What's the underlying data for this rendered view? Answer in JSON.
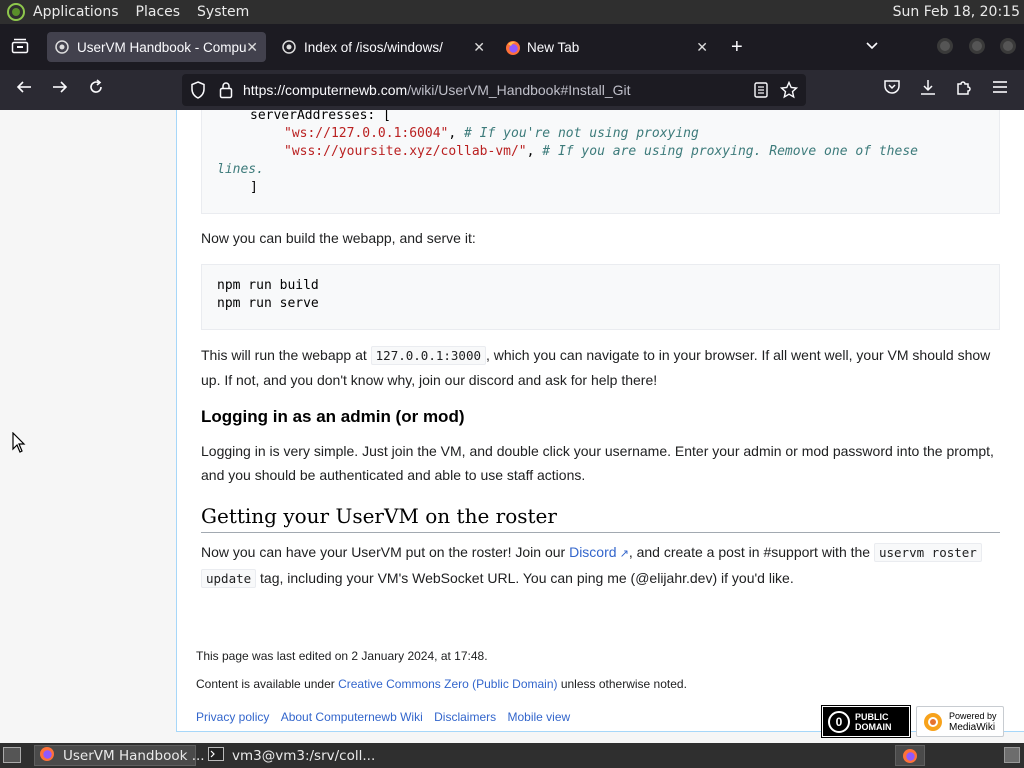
{
  "panel": {
    "menus": [
      "Applications",
      "Places",
      "System"
    ],
    "clock": "Sun Feb 18, 20:15"
  },
  "tabs": [
    {
      "label": "UserVM Handbook - Compu",
      "active": true
    },
    {
      "label": "Index of /isos/windows/",
      "active": false
    },
    {
      "label": "New Tab",
      "active": false
    }
  ],
  "url": {
    "host": "https://computernewb.com",
    "path": "/wiki/UserVM_Handbook#Install_Git"
  },
  "code1": {
    "line1": "serverAddresses: [",
    "str1": "\"ws://127.0.0.1:6004\"",
    "cmt1": "# If you're not using proxying",
    "str2": "\"wss://yoursite.xyz/collab-vm/\"",
    "cmt2": "# If you are using proxying. Remove one of these",
    "cmt2b": "lines.",
    "close": "]"
  },
  "para1": "Now you can build the webapp, and serve it:",
  "code2": {
    "line1": "npm run build",
    "line2": "npm run serve"
  },
  "para2": {
    "pre": "This will run the webapp at ",
    "code": "127.0.0.1:3000",
    "post": ", which you can navigate to in your browser. If all went well, your VM should show",
    "line2": "up. If not, and you don't know why, join our discord and ask for help there!"
  },
  "heading_admin": "Logging in as an admin (or mod)",
  "para3": {
    "line1": "Logging in is very simple. Just join the VM, and double click your username. Enter your admin or mod password into the prompt,",
    "line2": "and you should be authenticated and able to use staff actions."
  },
  "heading_roster": "Getting your UserVM on the roster",
  "para4": {
    "pre": "Now you can have your UserVM put on the roster! Join our ",
    "link": "Discord",
    "mid": ", and create a post in #support with the ",
    "code1": "uservm roster",
    "code2": "update",
    "post": " tag, including your VM's WebSocket URL. You can ping me (@elijahr.dev) if you'd like."
  },
  "footer": {
    "last_edited": "This page was last edited on 2 January 2024, at 17:48.",
    "license_pre": "Content is available under ",
    "license_link": "Creative Commons Zero (Public Domain)",
    "license_post": " unless otherwise noted.",
    "links": [
      "Privacy policy",
      "About Computernewb Wiki",
      "Disclaimers",
      "Mobile view"
    ],
    "badge_pd": "PUBLIC DOMAIN",
    "badge_mw_top": "Powered by",
    "badge_mw_bottom": "MediaWiki"
  },
  "taskbar": {
    "items": [
      "UserVM Handbook ...",
      "vm3@vm3:/srv/coll..."
    ]
  }
}
